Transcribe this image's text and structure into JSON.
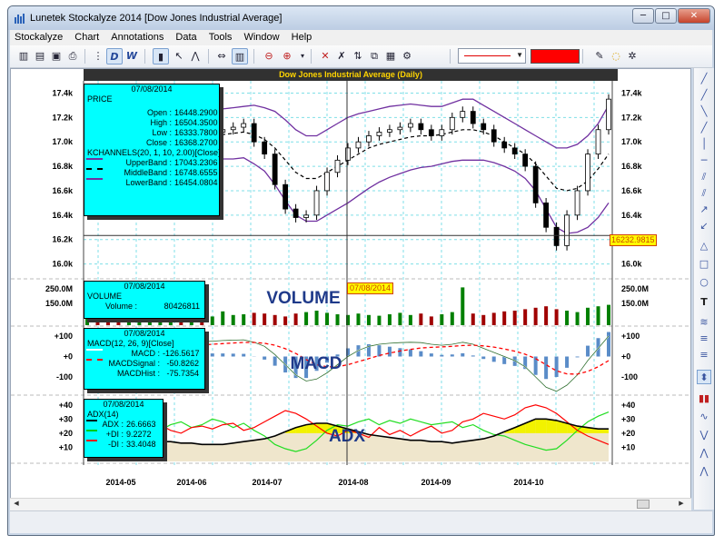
{
  "window": {
    "title": "Lunetek Stockalyze 2014 [Dow Jones Industrial Average]",
    "controls": {
      "minimize": "─",
      "maximize": "□",
      "close": "✕"
    }
  },
  "menu": [
    {
      "label": "Stockalyze"
    },
    {
      "label": "Chart"
    },
    {
      "label": "Annotations"
    },
    {
      "label": "Data"
    },
    {
      "label": "Tools"
    },
    {
      "label": "Window"
    },
    {
      "label": "Help"
    }
  ],
  "toolbar": {
    "line_color": "#ff0000",
    "icons": [
      "chart-bars-icon",
      "chart-list-icon",
      "save-icon",
      "print-icon",
      "daily-icon",
      "weekly-icon",
      "crosshair-icon",
      "pointer-icon",
      "trend-icon",
      "drag-icon",
      "volume-icon",
      "zoom-out-icon",
      "zoom-in-icon",
      "delete-drawing-icon",
      "clear-icon",
      "alert-icon",
      "copy-icon",
      "export-icon",
      "settings-icon",
      "idea-icon",
      "gear-icon"
    ]
  },
  "chart_data": [
    {
      "type": "candlestick",
      "title": "Dow Jones Industrial Average (Daily)",
      "x_ticks": [
        "2014-05",
        "2014-06",
        "2014-07",
        "2014-08",
        "2014-09",
        "2014-10"
      ],
      "y_ticks": [
        "17.4k",
        "17.2k",
        "17.0k",
        "16.8k",
        "16.6k",
        "16.4k",
        "16.2k",
        "16.0k"
      ],
      "ylim": [
        15900,
        17500
      ],
      "cursor_date": "07/08/2014",
      "cursor_value": "16232.9815",
      "infobox": {
        "date": "07/08/2014",
        "label": "PRICE",
        "ohlc": [
          {
            "k": "Open :",
            "v": "16448.2900"
          },
          {
            "k": "High :",
            "v": "16504.3500"
          },
          {
            "k": "Low :",
            "v": "16333.7800"
          },
          {
            "k": "Close :",
            "v": "16368.2700"
          }
        ],
        "indicator": "KCHANNELS(20, 1, 10, 2.00)[Close]",
        "bands": [
          {
            "k": "UpperBand :",
            "v": "17043.2306",
            "color": "#7030a0",
            "style": "solid"
          },
          {
            "k": "MiddleBand :",
            "v": "16748.6555",
            "color": "#000000",
            "style": "dashed"
          },
          {
            "k": "LowerBand :",
            "v": "16454.0804",
            "color": "#7030a0",
            "style": "solid"
          }
        ]
      },
      "close_path": [
        16950,
        16900,
        16850,
        16820,
        16900,
        16950,
        16980,
        17000,
        17050,
        17020,
        17060,
        17050,
        17080,
        17100,
        17120,
        17150,
        17000,
        16900,
        16650,
        16450,
        16380,
        16400,
        16600,
        16750,
        16850,
        16950,
        17000,
        17050,
        17080,
        17100,
        17120,
        17150,
        17100,
        17050,
        17100,
        17200,
        17250,
        17150,
        17100,
        17000,
        16950,
        16900,
        16800,
        16500,
        16300,
        16150,
        16400,
        16600,
        16900,
        17100,
        17350
      ],
      "upper_path": [
        17150,
        17100,
        17050,
        17020,
        17080,
        17120,
        17150,
        17170,
        17200,
        17210,
        17230,
        17250,
        17260,
        17270,
        17280,
        17290,
        17300,
        17280,
        17250,
        17180,
        17100,
        17050,
        17050,
        17100,
        17150,
        17200,
        17230,
        17250,
        17270,
        17290,
        17300,
        17310,
        17300,
        17290,
        17290,
        17320,
        17350,
        17350,
        17300,
        17250,
        17200,
        17150,
        17100,
        17050,
        17000,
        16950,
        16950,
        16980,
        17050,
        17150,
        17300
      ],
      "middle_path": [
        16950,
        16920,
        16880,
        16860,
        16880,
        16920,
        16950,
        16970,
        17000,
        17010,
        17030,
        17040,
        17050,
        17060,
        17070,
        17080,
        17060,
        17020,
        16950,
        16850,
        16750,
        16700,
        16700,
        16750,
        16800,
        16850,
        16900,
        16950,
        16980,
        17000,
        17020,
        17040,
        17050,
        17050,
        17060,
        17080,
        17100,
        17100,
        17080,
        17050,
        17000,
        16950,
        16900,
        16820,
        16720,
        16620,
        16600,
        16620,
        16680,
        16780,
        16900
      ],
      "lower_path": [
        16750,
        16720,
        16690,
        16680,
        16690,
        16720,
        16750,
        16770,
        16800,
        16810,
        16830,
        16840,
        16850,
        16860,
        16860,
        16870,
        16820,
        16760,
        16650,
        16520,
        16400,
        16350,
        16350,
        16400,
        16450,
        16500,
        16560,
        16620,
        16670,
        16710,
        16740,
        16770,
        16790,
        16800,
        16820,
        16840,
        16850,
        16850,
        16850,
        16830,
        16800,
        16760,
        16700,
        16600,
        16450,
        16300,
        16250,
        16260,
        16300,
        16380,
        16500
      ]
    },
    {
      "type": "bar",
      "title": "VOLUME",
      "y_ticks": [
        "250.0M",
        "150.0M"
      ],
      "ylim": [
        0,
        300000000
      ],
      "infobox": {
        "date": "07/08/2014",
        "label": "VOLUME",
        "rows": [
          {
            "k": "Volume :",
            "v": "80426811"
          }
        ]
      },
      "values_m": [
        95,
        80,
        70,
        85,
        90,
        75,
        60,
        70,
        88,
        65,
        72,
        80,
        60,
        95,
        70,
        75,
        85,
        80,
        70,
        60,
        80,
        90,
        100,
        85,
        75,
        70,
        80,
        70,
        65,
        75,
        85,
        70,
        80,
        60,
        75,
        90,
        260,
        80,
        70,
        85,
        95,
        100,
        110,
        120,
        130,
        110,
        100,
        90,
        120,
        130,
        140
      ]
    },
    {
      "type": "line",
      "title": "MACD",
      "y_ticks": [
        "+100",
        "+0",
        "-100"
      ],
      "ylim": [
        -180,
        140
      ],
      "infobox": {
        "date": "07/08/2014",
        "label": "MACD(12, 26, 9)[Close]",
        "rows": [
          {
            "k": "MACD :",
            "v": "-126.5617"
          },
          {
            "k": "MACDSignal :",
            "v": "-50.8262"
          },
          {
            "k": "MACDHist :",
            "v": "-75.7354"
          }
        ]
      },
      "macd": [
        40,
        30,
        20,
        15,
        20,
        30,
        40,
        50,
        60,
        65,
        70,
        72,
        75,
        78,
        80,
        82,
        70,
        50,
        10,
        -40,
        -90,
        -120,
        -110,
        -80,
        -40,
        0,
        30,
        50,
        60,
        65,
        68,
        70,
        68,
        60,
        55,
        60,
        70,
        60,
        40,
        20,
        0,
        -20,
        -50,
        -100,
        -150,
        -170,
        -140,
        -90,
        -20,
        40,
        100
      ],
      "signal": [
        50,
        45,
        40,
        35,
        32,
        32,
        34,
        38,
        42,
        47,
        52,
        56,
        60,
        63,
        66,
        69,
        69,
        65,
        55,
        38,
        15,
        -15,
        -40,
        -50,
        -50,
        -40,
        -25,
        -10,
        5,
        17,
        27,
        35,
        42,
        45,
        47,
        50,
        54,
        55,
        52,
        46,
        37,
        26,
        11,
        -10,
        -40,
        -70,
        -85,
        -86,
        -73,
        -50,
        -20
      ]
    },
    {
      "type": "line",
      "title": "ADX",
      "y_ticks": [
        "+40",
        "+30",
        "+20",
        "+10"
      ],
      "ylim": [
        0,
        45
      ],
      "infobox": {
        "date": "07/08/2014",
        "label": "ADX(14)",
        "rows": [
          {
            "k": "ADX :",
            "v": "26.6663",
            "color": "#000000"
          },
          {
            "k": "+DI :",
            "v": "9.2272",
            "color": "#00cc00"
          },
          {
            "k": "-DI :",
            "v": "33.4048",
            "color": "#ff0000"
          }
        ]
      },
      "adx": [
        8,
        9,
        10,
        11,
        12,
        12,
        13,
        14,
        14,
        13,
        13,
        12,
        12,
        12,
        13,
        14,
        15,
        16,
        18,
        21,
        24,
        26,
        27,
        27,
        25,
        23,
        21,
        19,
        18,
        17,
        16,
        15,
        15,
        14,
        14,
        13,
        14,
        15,
        16,
        18,
        21,
        24,
        27,
        30,
        30,
        29,
        27,
        25,
        24,
        23,
        23
      ],
      "plus_di": [
        22,
        20,
        18,
        19,
        24,
        27,
        24,
        22,
        26,
        28,
        24,
        26,
        30,
        28,
        24,
        27,
        22,
        18,
        12,
        9,
        7,
        9,
        15,
        22,
        26,
        25,
        28,
        30,
        26,
        29,
        27,
        30,
        28,
        26,
        27,
        28,
        24,
        26,
        22,
        19,
        18,
        15,
        12,
        10,
        8,
        9,
        15,
        22,
        28,
        32,
        35
      ],
      "minus_di": [
        26,
        28,
        30,
        28,
        22,
        20,
        24,
        26,
        22,
        20,
        24,
        25,
        23,
        26,
        27,
        22,
        24,
        28,
        32,
        36,
        34,
        30,
        25,
        20,
        18,
        22,
        20,
        17,
        24,
        19,
        22,
        18,
        22,
        25,
        20,
        22,
        28,
        30,
        34,
        32,
        30,
        33,
        38,
        40,
        38,
        34,
        28,
        22,
        18,
        15,
        12
      ]
    }
  ]
}
